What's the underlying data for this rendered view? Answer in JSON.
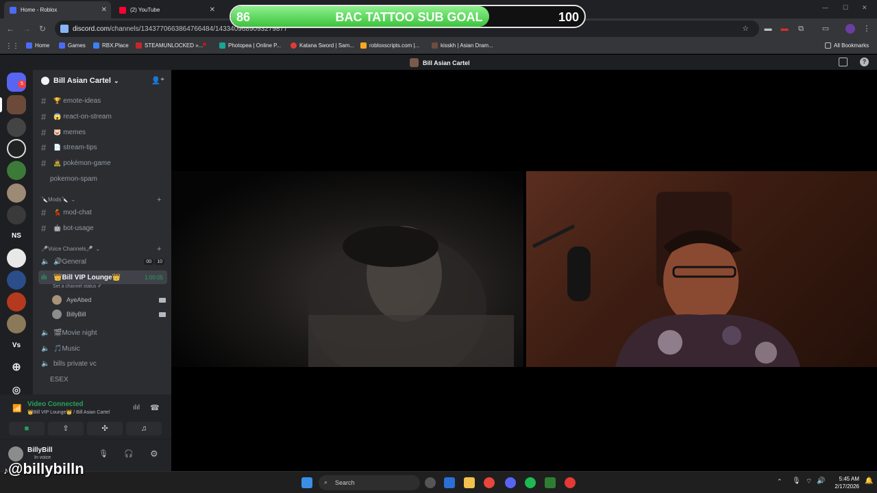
{
  "browser": {
    "tabs": [
      {
        "title": "Home - Roblox",
        "close": "✕"
      },
      {
        "title": "(2) YouTube",
        "close": "✕"
      }
    ],
    "url_host": "discord.com",
    "url_path": "/channels/1343770663864766484/1433409689093279877",
    "bookmarks": [
      "Home",
      "Games",
      "RBX.Place",
      "STEAMUNLOCKED »...",
      "Photopea | Online P...",
      "Katana Sword | Sam...",
      "robloxscripts.com |...",
      "kisskh | Asian Dram..."
    ],
    "all_bookmarks": "All Bookmarks"
  },
  "overlay": {
    "current": "86",
    "label": "BAC TATTOO SUB GOAL",
    "target": "100",
    "progress": 0.86
  },
  "discord": {
    "title_bar": "Bill Asian Cartel",
    "rail_badge": "5",
    "rail_ns": "NS",
    "rail_vs": "Vs",
    "server_name": "Bill Asian Cartel",
    "channels": [
      {
        "emoji": "🏆",
        "name": "emote-ideas"
      },
      {
        "emoji": "😱",
        "name": "react-on-stream"
      },
      {
        "emoji": "🐷",
        "name": "memes"
      },
      {
        "emoji": "📄",
        "name": "stream-tips"
      },
      {
        "emoji": "🧟",
        "name": "pokémon-game"
      },
      {
        "emoji": "",
        "name": "pokemon-spam"
      }
    ],
    "mods_category": "🔪Mods🔪",
    "mod_channels": [
      {
        "emoji": "💃",
        "name": "mod-chat"
      },
      {
        "emoji": "🤖",
        "name": "bot-usage"
      }
    ],
    "voice_category": "🎤Voice Channels🎤",
    "voice_general": {
      "name": "🔊General",
      "count_a": "00",
      "count_b": "10"
    },
    "voice_active": {
      "name": "👑Bill VIP Lounge👑",
      "timer": "1:00:05",
      "status": "Set a channel status ✐"
    },
    "members": [
      "AyeAbed",
      "BillyBill"
    ],
    "voice_others": [
      "🎬Movie night",
      "🎵Music",
      "bills private vc",
      "ESEX"
    ],
    "voice_panel": {
      "status": "Video Connected",
      "location": "👑Bill VIP Lounge👑 / Bill Asian Cartel"
    },
    "user": {
      "name": "BillyBill",
      "status": "In voice"
    }
  },
  "taskbar": {
    "search": "Search",
    "time": "5:45 AM",
    "date": "2/17/2026"
  },
  "watermark": "@billybilln",
  "colors": {
    "goal_fill": "#3cc43c",
    "discord_bg": "#2b2d31",
    "connected": "#23a55a"
  }
}
